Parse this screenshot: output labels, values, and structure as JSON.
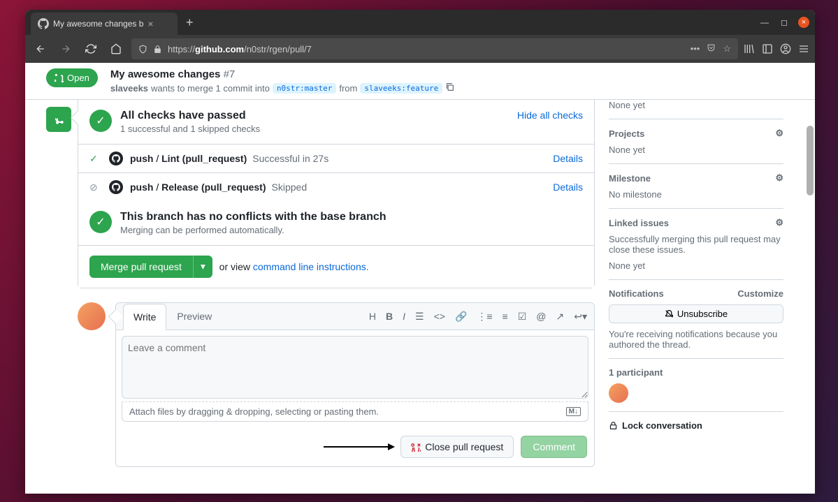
{
  "browser": {
    "tab_title": "My awesome changes b",
    "url_prefix": "https://",
    "url_domain": "github.com",
    "url_path": "/n0str/rgen/pull/7"
  },
  "pr": {
    "state": "Open",
    "title": "My awesome changes",
    "number": "#7",
    "author": "slaveeks",
    "wants_text": " wants to merge 1 commit into ",
    "base_branch": "n0str:master",
    "from_text": " from ",
    "head_branch": "slaveeks:feature"
  },
  "checks": {
    "title": "All checks have passed",
    "subtitle": "1 successful and 1 skipped checks",
    "hide_link": "Hide all checks",
    "items": [
      {
        "prefix": "push",
        "name": "Lint (pull_request)",
        "status": "Successful in 27s",
        "link": "Details",
        "icon": "check"
      },
      {
        "prefix": "push",
        "name": "Release (pull_request)",
        "status": "Skipped",
        "link": "Details",
        "icon": "skip"
      }
    ]
  },
  "conflicts": {
    "title": "This branch has no conflicts with the base branch",
    "subtitle": "Merging can be performed automatically."
  },
  "merge": {
    "button": "Merge pull request",
    "or": "or view ",
    "cmd_link": "command line instructions."
  },
  "comment": {
    "write_tab": "Write",
    "preview_tab": "Preview",
    "placeholder": "Leave a comment",
    "attach_text": "Attach files by dragging & dropping, selecting or pasting them.",
    "close_btn": "Close pull request",
    "comment_btn": "Comment"
  },
  "sidebar": {
    "none_yet_top": "None yet",
    "projects": {
      "title": "Projects",
      "text": "None yet"
    },
    "milestone": {
      "title": "Milestone",
      "text": "No milestone"
    },
    "linked": {
      "title": "Linked issues",
      "text": "Successfully merging this pull request may close these issues.",
      "none": "None yet"
    },
    "notifications": {
      "title": "Notifications",
      "customize": "Customize",
      "unsub": "Unsubscribe",
      "reason": "You're receiving notifications because you authored the thread."
    },
    "participants": {
      "title": "1 participant"
    },
    "lock": "Lock conversation"
  }
}
